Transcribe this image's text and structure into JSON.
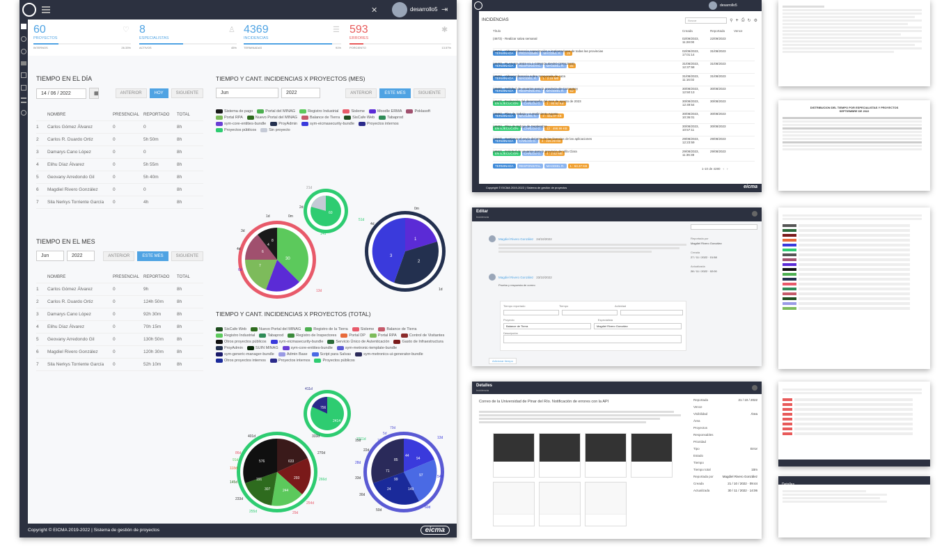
{
  "header": {
    "user": "desarrollo5",
    "user_alt": "desarrollo5"
  },
  "stats": [
    {
      "value": "60",
      "label": "PROYECTOS",
      "sub_left": "INTERNOS",
      "sub_right": "26.33%"
    },
    {
      "value": "8",
      "label": "ESPECIALISTAS",
      "sub_left": "ACTIVOS",
      "sub_right": "45%"
    },
    {
      "value": "4369",
      "label": "INCIDENCIAS",
      "sub_left": "TERMINADAS",
      "sub_right": "91%"
    },
    {
      "value": "593",
      "label": "ERRORES",
      "sub_left": "PORCIENTO",
      "sub_right": "13.57%"
    }
  ],
  "day": {
    "title": "TIEMPO EN EL DÍA",
    "date": "14 / 06 / 2022",
    "buttons": [
      "ANTERIOR",
      "HOY",
      "SIGUIENTE"
    ],
    "columns": [
      "NOMBRE",
      "PRESENCIAL",
      "REPORTADO",
      "TOTAL"
    ],
    "rows": [
      [
        "1",
        "Carlos Gómez Álvarez",
        "0",
        "0",
        "8h"
      ],
      [
        "2",
        "Carlos R. Duardo Ortiz",
        "0",
        "5h 50m",
        "8h"
      ],
      [
        "3",
        "Damarys Cano López",
        "0",
        "0",
        "8h"
      ],
      [
        "4",
        "Elihu Díaz Álvarez",
        "0",
        "5h 55m",
        "8h"
      ],
      [
        "5",
        "Geovany Arredondo Gil",
        "0",
        "5h 40m",
        "8h"
      ],
      [
        "6",
        "Magdiel Rivero González",
        "0",
        "0",
        "8h"
      ],
      [
        "7",
        "Sila Nerkys Torriente García",
        "0",
        "4h",
        "8h"
      ]
    ]
  },
  "month": {
    "title": "TIEMPO EN EL MES",
    "month": "Jun",
    "year": "2022",
    "buttons": [
      "ANTERIOR",
      "ESTE MES",
      "SIGUIENTE"
    ],
    "columns": [
      "NOMBRE",
      "PRESENCIAL",
      "REPORTADO",
      "TOTAL"
    ],
    "rows": [
      [
        "1",
        "Carlos Gómez Álvarez",
        "0",
        "9h",
        "8h"
      ],
      [
        "2",
        "Carlos R. Duardo Ortiz",
        "0",
        "124h 50m",
        "8h"
      ],
      [
        "3",
        "Damarys Cano López",
        "0",
        "92h 30m",
        "8h"
      ],
      [
        "4",
        "Elihu Díaz Álvarez",
        "0",
        "70h 15m",
        "8h"
      ],
      [
        "5",
        "Geovany Arredondo Gil",
        "0",
        "130h 50m",
        "8h"
      ],
      [
        "6",
        "Magdiel Rivero González",
        "0",
        "120h 30m",
        "8h"
      ],
      [
        "7",
        "Sila Nerkys Torriente García",
        "0",
        "52h 10m",
        "8h"
      ]
    ]
  },
  "proj_month": {
    "title": "TIEMPO Y CANT. INCIDENCIAS X PROYECTOS (MES)",
    "month": "Jun",
    "year": "2022",
    "buttons": [
      "ANTERIOR",
      "ESTE MES",
      "SIGUIENTE"
    ],
    "legend": [
      {
        "name": "Sistema de pago",
        "color": "#1a1a1a"
      },
      {
        "name": "Portal del MINAG",
        "color": "#4caf50"
      },
      {
        "name": "Registro Industrial",
        "color": "#5cc95c"
      },
      {
        "name": "Sisleme",
        "color": "#e85a6a"
      },
      {
        "name": "Moodle ERMA",
        "color": "#5b2bd6"
      },
      {
        "name": "Poklasoft",
        "color": "#a0506e"
      },
      {
        "name": "Portal RPA",
        "color": "#7dbb5b"
      },
      {
        "name": "Nuevo Portal del MINAG",
        "color": "#2e6b1e"
      },
      {
        "name": "Balance de Tierra",
        "color": "#c55a6a"
      },
      {
        "name": "SisCafe Web",
        "color": "#1f4d1f"
      },
      {
        "name": "Tabaprod",
        "color": "#2e8b57"
      },
      {
        "name": "sym-core-entities-bundle",
        "color": "#6a3fd4"
      },
      {
        "name": "ProyAdmin",
        "color": "#23304f"
      },
      {
        "name": "sym-eicmasecurity-bundle",
        "color": "#3a3adc"
      },
      {
        "name": "Proyectos internos",
        "color": "#2a2a8a"
      },
      {
        "name": "Proyectos públicos",
        "color": "#2ecc71"
      },
      {
        "name": "Sin proyecto",
        "color": "#c5cad6"
      }
    ],
    "pie_labels": [
      "21d",
      "2d",
      "60",
      "1d",
      "0m",
      "51d",
      "1d",
      "0m",
      "14d",
      "3d",
      "4d",
      "6d",
      "13d",
      "30",
      "6",
      "7",
      "4",
      "8",
      "6d",
      "4d",
      "1",
      "2",
      "3",
      "0m",
      "1d",
      "4d"
    ]
  },
  "proj_total": {
    "title": "TIEMPO Y CANT. INCIDENCIAS X PROYECTOS (TOTAL)",
    "legend": [
      {
        "name": "SisCafe Web",
        "color": "#1f4d1f"
      },
      {
        "name": "Nuevo Portal del MINAG",
        "color": "#2e6b1e"
      },
      {
        "name": "Registro de la Tierra",
        "color": "#4caf50"
      },
      {
        "name": "Sisleme",
        "color": "#e85a6a"
      },
      {
        "name": "Balance de Tierra",
        "color": "#c55a6a"
      },
      {
        "name": "Registro Industrial",
        "color": "#5cc95c"
      },
      {
        "name": "Tabaprod",
        "color": "#2e8b57"
      },
      {
        "name": "Registro de Inspectores",
        "color": "#3a8a3a"
      },
      {
        "name": "Portal DP",
        "color": "#e86a3a"
      },
      {
        "name": "Portal RPA",
        "color": "#7dbb5b"
      },
      {
        "name": "Control de Visitantes",
        "color": "#8a2a2a"
      },
      {
        "name": "Otros proyectos públicos",
        "color": "#101010"
      },
      {
        "name": "sym-eicmasecurity-bundle",
        "color": "#3a3adc"
      },
      {
        "name": "Servicio Único de Autenticación",
        "color": "#2a6a3a"
      },
      {
        "name": "Gasto de Infraestructura",
        "color": "#7a1a1a"
      },
      {
        "name": "ProyAdmin",
        "color": "#23304f"
      },
      {
        "name": "SUIN MINAG",
        "color": "#0a2a0a"
      },
      {
        "name": "sym-core-entities-bundle",
        "color": "#6a3fd4"
      },
      {
        "name": "sym-metronic-template-bundle",
        "color": "#5a5ad4"
      },
      {
        "name": "sym-generic-manager-bundle",
        "color": "#1a1a6a"
      },
      {
        "name": "Admin Base",
        "color": "#9a9ae4"
      },
      {
        "name": "Script para Salvas",
        "color": "#4a6ae4"
      },
      {
        "name": "sym-metronics-ui-generator-bundle",
        "color": "#2a2a5a"
      },
      {
        "name": "Otros proyectos internos",
        "color": "#1a2a9a"
      },
      {
        "name": "Proyectos internos",
        "color": "#2a2a8a"
      },
      {
        "name": "Proyectos públicos",
        "color": "#2ecc71"
      }
    ],
    "pie_labels": [
      "411d",
      "756",
      "2414",
      "333d",
      "2311d",
      "401d",
      "86d",
      "91d",
      "118d",
      "145d",
      "233d",
      "255d",
      "576",
      "633",
      "293",
      "307",
      "244",
      "191",
      "270d",
      "266d",
      "254d",
      "29d",
      "15d",
      "5d",
      "79d",
      "13d",
      "19d",
      "22d",
      "28d",
      "33d",
      "30d",
      "50d",
      "54d",
      "60d",
      "85",
      "44",
      "94",
      "97",
      "99",
      "149",
      "24",
      "71"
    ]
  },
  "footer": {
    "text": "Copyright © EICMA 2019-2022 | Sistema de gestión de proyectos",
    "brand": "eicma"
  },
  "incidencias": {
    "title": "INCIDENCIAS",
    "search_placeholder": "Buscar",
    "columns": [
      "Título",
      "Creada",
      "Reportada",
      "Vence"
    ],
    "rows": [
      {
        "title": "(4673) - Realizar salva semanal",
        "created": "02/09/2023, 11:28:00",
        "reported": "22/09/2023",
        "tags": [
          "TERMINADA",
          "PROYADMIN",
          "MAGDIEL R.",
          "2h"
        ]
      },
      {
        "title": "(4671) - Videoconferencia capacitación a implantadores de todas las provincias",
        "created": "02/09/2023, 17:01:14",
        "reported": "31/08/2023",
        "tags": [
          "TERMINADA",
          "RESPONSITAL",
          "MAGDIEL R.",
          "2d"
        ]
      },
      {
        "title": "(4670) - PLAN MA 2023 V1.1 CONSOLIDADO (27012023)",
        "created": "31/08/2023, 12:37:58",
        "reported": "31/08/2023",
        "tags": [
          "TERMINADA",
          "MAGDIEL R.",
          "1 : 2.19 MB"
        ]
      },
      {
        "title": "(4669) - Videoconferencia sobre temporada de caza",
        "created": "31/08/2023, 11:16:02",
        "reported": "31/08/2023",
        "tags": [
          "TERMINADA",
          "RESPONSITAL",
          "MAGDIEL R.",
          "2d"
        ]
      },
      {
        "title": "(4668) - Solicitud de usuarios para la provincia de Camagüey",
        "created": "30/08/2023, 12:50:13",
        "reported": "30/08/2023",
        "tags": [
          "EN EJECUCIÓN",
          "CARLOS G.",
          "1 : 90.92 KB"
        ]
      },
      {
        "title": "(4667) - Evaluación del desempeño del mes de agosto de 2023",
        "created": "30/08/2023, 12:49:54",
        "reported": "30/08/2023",
        "tags": [
          "TERMINADA",
          "MAGDIEL R.",
          "2 : 428.07 KB"
        ]
      },
      {
        "title": "(4666) - Plan de trabajo y cumplimiento Agosto",
        "created": "30/08/2023, 10:36:01",
        "reported": "30/08/2023",
        "tags": [
          "EN EJECUCIÓN",
          "CARLOS G.",
          "12 : 498.99 KB"
        ]
      },
      {
        "title": "(4665) - Plan de trabajo de Septiembre",
        "created": "30/08/2023, 10:57:11",
        "reported": "30/08/2023",
        "tags": [
          "TERMINADA",
          "CARLOS G.",
          "4 : 225.29 KB"
        ]
      },
      {
        "title": "(4663) - Gestionar el envío del 30% de las licencias de las aplicaciones",
        "created": "29/08/2023, 12:23:59",
        "reported": "29/08/2023",
        "tags": [
          "EN EJECUCIÓN",
          "CARLOS G.",
          "4 : 2.62 MB"
        ]
      },
      {
        "title": "(4662) - Solicitud de usuarios para la provincia de Villa Clara",
        "created": "29/08/2023, 11:36:38",
        "reported": "29/08/2023",
        "tags": [
          "TERMINADA",
          "RESPONSITAL",
          "MAGDIEL R.",
          "1 : 63.37 KB"
        ]
      }
    ],
    "pager": "1-10 de 4280"
  },
  "editar": {
    "title": "Editar",
    "subtitle": "Incidencia",
    "author1": "Magdiel Rivero González",
    "date1": "24/10/2022",
    "author2": "Magdiel Rivero González",
    "date2": "23/10/2022",
    "note2": "Prueba y respuesta de correo",
    "side_labels": [
      "Reportada por",
      "Creada",
      "Actualizada"
    ],
    "side_values": [
      "Magdiel Rivero González",
      "27 / 11 / 2022 · 01:58",
      "28 / 11 / 2022 · 02:00"
    ],
    "form_labels": [
      "Tiempo reportado",
      "Tiempo",
      "Actividad",
      "Proyecto",
      "Especialista",
      "Descripción"
    ],
    "project_value": "Balance de Tierra",
    "specialist_value": "Magdiel Rivero González",
    "add_button": "Adicionar tiempo"
  },
  "detalles": {
    "title": "Detalles",
    "subtitle": "Incidencia",
    "heading": "Correo de la Universidad de Pinar del Río. Notificación de errores con la API",
    "side_labels": [
      "Reportada",
      "Vence",
      "Visibilidad",
      "Área",
      "Proyectos",
      "Responsables",
      "Prioridad",
      "Tipo",
      "Estado",
      "Tiempo",
      "Tiempo total",
      "Reportada por",
      "Creada",
      "Actualizada"
    ],
    "side_values": [
      "21 / 10 / 2022",
      "",
      "Área",
      "",
      "",
      "",
      "",
      "Error",
      "",
      "",
      "10m",
      "Magdiel Rivero González",
      "21 / 10 / 2022 · 09:44",
      "30 / 11 / 2022 · 14:06"
    ]
  },
  "side_reports": {
    "report_title": "DISTRIBUCION DEL TIEMPO POR ESPECIALISTAS Y PROYECTOS",
    "report_subtitle": "SEPTIEMBRE DE 2022",
    "detalles2": "Detalles"
  }
}
